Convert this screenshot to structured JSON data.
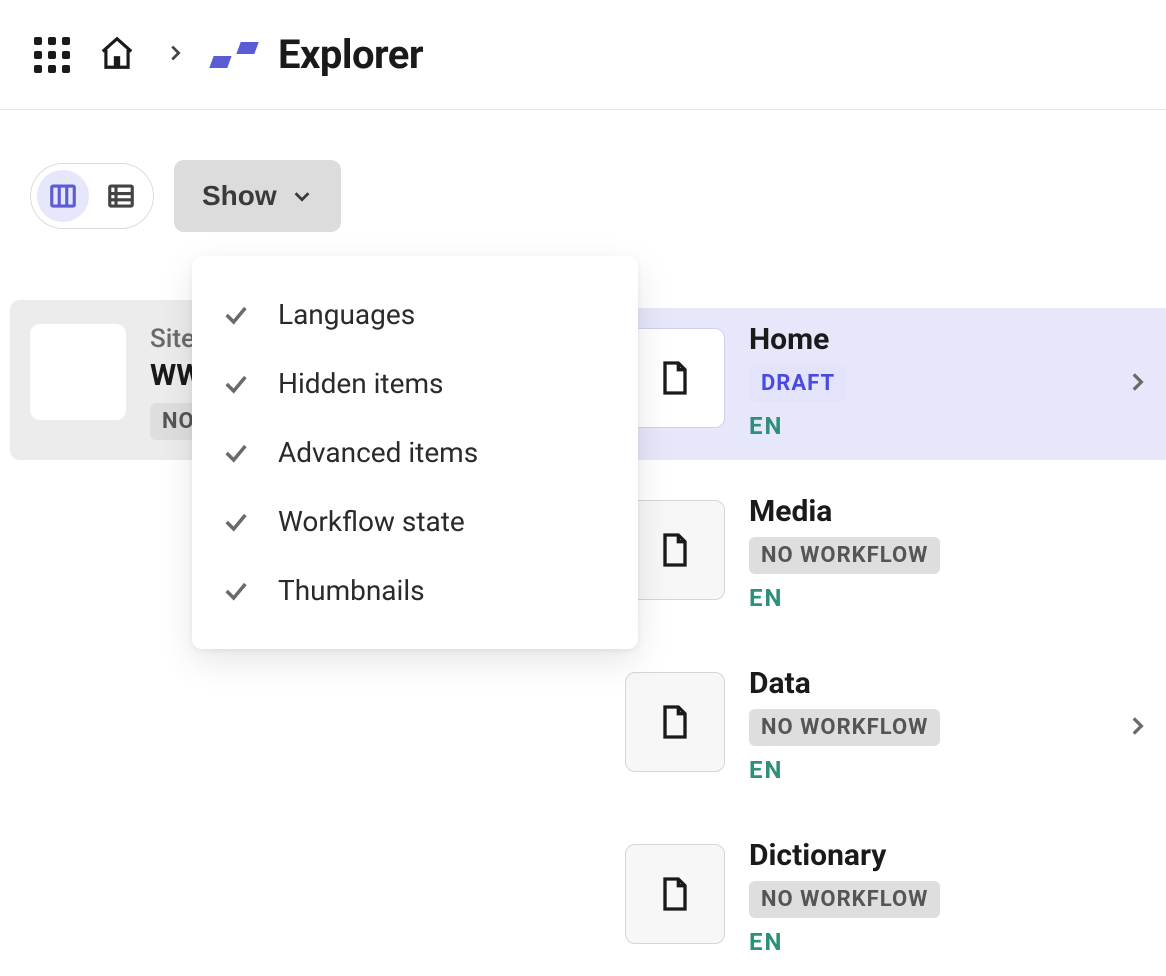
{
  "header": {
    "title": "Explorer"
  },
  "toolbar": {
    "show_label": "Show"
  },
  "dropdown": {
    "items": [
      {
        "label": "Languages"
      },
      {
        "label": "Hidden items"
      },
      {
        "label": "Advanced items"
      },
      {
        "label": "Workflow state"
      },
      {
        "label": "Thumbnails"
      }
    ]
  },
  "left": {
    "site_label": "Site",
    "site_name": "WW",
    "badge": "NO"
  },
  "content": {
    "items": [
      {
        "title": "Home",
        "badge": "DRAFT",
        "badge_class": "draft",
        "lang": "EN",
        "selected": true,
        "has_chevron": true
      },
      {
        "title": "Media",
        "badge": "NO WORKFLOW",
        "badge_class": "",
        "lang": "EN",
        "selected": false,
        "has_chevron": false
      },
      {
        "title": "Data",
        "badge": "NO WORKFLOW",
        "badge_class": "",
        "lang": "EN",
        "selected": false,
        "has_chevron": true
      },
      {
        "title": "Dictionary",
        "badge": "NO WORKFLOW",
        "badge_class": "",
        "lang": "EN",
        "selected": false,
        "has_chevron": false
      }
    ]
  }
}
